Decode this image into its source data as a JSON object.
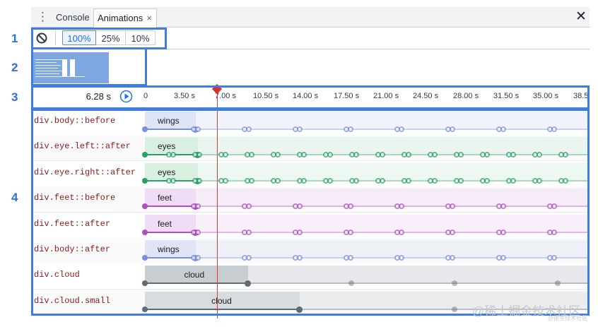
{
  "tabs": {
    "console_label": "Console",
    "animations_label": "Animations",
    "close_tab_glyph": "×",
    "menu_glyph": "⋮",
    "close_panel_glyph": "✕"
  },
  "toolbar": {
    "clear_icon": "clear-circle-slash-icon",
    "speeds": [
      "100%",
      "25%",
      "10%"
    ],
    "selected_speed": "100%"
  },
  "preview": {
    "state": "paused",
    "thumb_color": "#7ea6e0"
  },
  "timeline": {
    "current_time": "6.28 s",
    "ticks": [
      "0",
      "3.50 s",
      "7.00 s",
      "10.50 s",
      "14.00 s",
      "17.50 s",
      "21.00 s",
      "24.50 s",
      "28.00 s",
      "31.50 s",
      "35.00 s",
      "38.5"
    ],
    "playhead_color": "#d93025"
  },
  "animations": [
    {
      "selector": "div.body::before",
      "name": "wings",
      "color": "#7b8ee0",
      "fill": "#dfe4f7"
    },
    {
      "selector": "div.eye.left::after",
      "name": "eyes",
      "color": "#2e9e67",
      "fill": "#d8efe2"
    },
    {
      "selector": "div.eye.right::after",
      "name": "eyes",
      "color": "#2e9e67",
      "fill": "#d8efe2"
    },
    {
      "selector": "div.feet::before",
      "name": "feet",
      "color": "#b04fc4",
      "fill": "#f0dcf4"
    },
    {
      "selector": "div.feet::after",
      "name": "feet",
      "color": "#b04fc4",
      "fill": "#f0dcf4"
    },
    {
      "selector": "div.body::after",
      "name": "wings",
      "color": "#7b8ee0",
      "fill": "#dfe4f7"
    },
    {
      "selector": "div.cloud",
      "name": "cloud",
      "color": "#5f6b75",
      "fill": "#c8cdd2"
    },
    {
      "selector": "div.cloud.small",
      "name": "cloud",
      "color": "#5f6b75",
      "fill": "#d8dcdf"
    }
  ],
  "callouts": [
    "1",
    "2",
    "3",
    "4"
  ],
  "watermark": {
    "main": "@稀土掘金技术社区",
    "sub": "@掘金技术社区"
  },
  "colors": {
    "accent": "#3f7de0",
    "selected_speed_text": "#1a73e8",
    "selector_text": "#8a1a1a"
  }
}
